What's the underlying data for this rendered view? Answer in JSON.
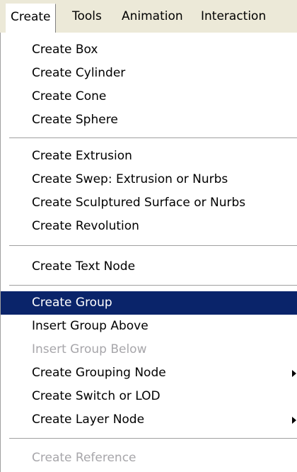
{
  "menubar": {
    "items": [
      {
        "label": "Create"
      },
      {
        "label": "Tools"
      },
      {
        "label": "Animation"
      },
      {
        "label": "Interaction"
      }
    ]
  },
  "create_menu": {
    "items": [
      {
        "label": "Create Box",
        "enabled": true
      },
      {
        "label": "Create Cylinder",
        "enabled": true
      },
      {
        "label": "Create Cone",
        "enabled": true
      },
      {
        "label": "Create Sphere",
        "enabled": true
      },
      {
        "label": "Create Extrusion",
        "enabled": true
      },
      {
        "label": "Create Swep: Extrusion or Nurbs",
        "enabled": true
      },
      {
        "label": "Create Sculptured Surface or Nurbs",
        "enabled": true
      },
      {
        "label": "Create Revolution",
        "enabled": true
      },
      {
        "label": "Create Text Node",
        "enabled": true
      },
      {
        "label": "Create Group",
        "enabled": true,
        "highlighted": true
      },
      {
        "label": "Insert Group Above",
        "enabled": true
      },
      {
        "label": "Insert Group Below",
        "enabled": false
      },
      {
        "label": "Create Grouping Node",
        "enabled": true,
        "submenu": true
      },
      {
        "label": "Create Switch or LOD",
        "enabled": true
      },
      {
        "label": "Create Layer Node",
        "enabled": true,
        "submenu": true
      },
      {
        "label": "Create Reference",
        "enabled": false
      }
    ]
  },
  "colors": {
    "highlight_bg": "#0a246a",
    "highlight_text": "#ffffff",
    "disabled_text": "#a7a6aa",
    "menubar_bg": "#ece9d8"
  }
}
